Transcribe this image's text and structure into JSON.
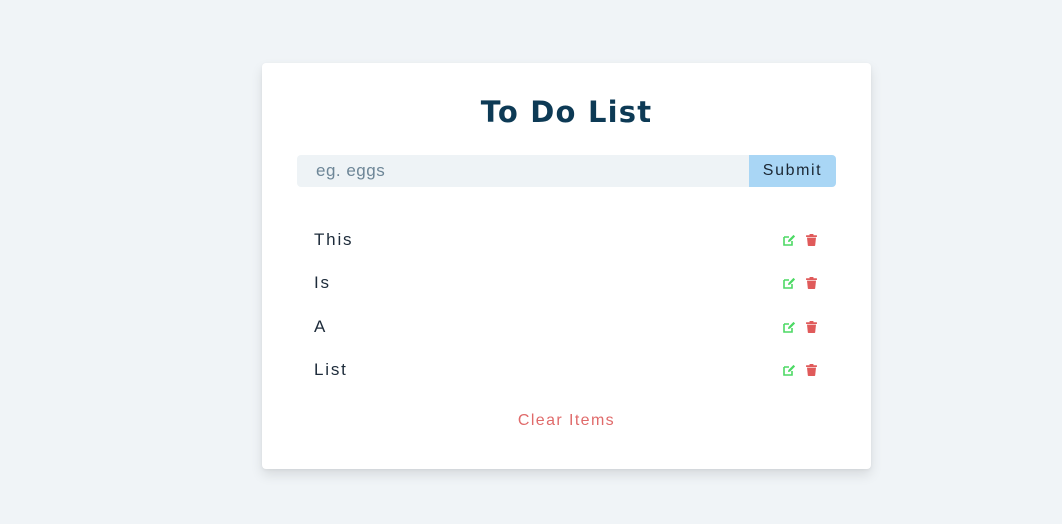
{
  "app": {
    "title": "To Do List"
  },
  "form": {
    "placeholder": "eg. eggs",
    "value": "",
    "submit_label": "Submit"
  },
  "items": [
    {
      "label": "This"
    },
    {
      "label": "Is"
    },
    {
      "label": "A"
    },
    {
      "label": "List"
    }
  ],
  "icons": {
    "edit": "edit-icon",
    "delete": "trash-icon"
  },
  "colors": {
    "background": "#f0f4f7",
    "title": "#0d3a55",
    "submit_bg": "#a9d6f5",
    "edit_icon": "#4cd964",
    "delete_icon": "#e05a5a",
    "clear_text": "#e06a6a"
  },
  "footer": {
    "clear_label": "Clear Items"
  }
}
